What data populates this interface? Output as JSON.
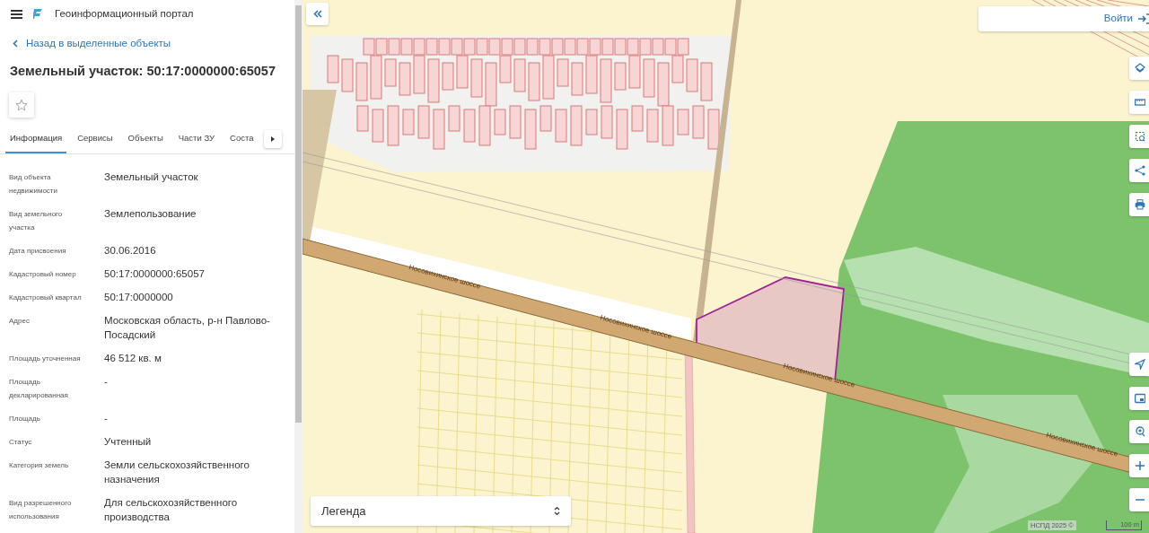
{
  "header": {
    "title": "Геоинформационный портал"
  },
  "back_link": "Назад в выделенные объекты",
  "object_title": "Земельный участок: 50:17:0000000:65057",
  "favorite": {
    "checked": false
  },
  "tabs": [
    {
      "label": "Информация",
      "selected": true
    },
    {
      "label": "Сервисы",
      "selected": false
    },
    {
      "label": "Объекты",
      "selected": false
    },
    {
      "label": "Части ЗУ",
      "selected": false
    },
    {
      "label": "Соста",
      "selected": false
    }
  ],
  "fields": [
    {
      "label": "Вид объекта недвижимости",
      "value": "Земельный участок"
    },
    {
      "label": "Вид земельного участка",
      "value": "Землепользование"
    },
    {
      "label": "Дата присвоения",
      "value": "30.06.2016"
    },
    {
      "label": "Кадастровый номер",
      "value": "50:17:0000000:65057"
    },
    {
      "label": "Кадастровый квартал",
      "value": "50:17:0000000"
    },
    {
      "label": "Адрес",
      "value": "Московская область, р-н Павлово-Посадский"
    },
    {
      "label": "Площадь уточненная",
      "value": "46 512 кв. м"
    },
    {
      "label": "Площадь декларированная",
      "value": "-"
    },
    {
      "label": "Площадь",
      "value": "-"
    },
    {
      "label": "Статус",
      "value": "Учтенный"
    },
    {
      "label": "Категория земель",
      "value": "Земли сельскохозяйственного назначения"
    },
    {
      "label": "Вид разрешенного использования",
      "value": "Для сельскохозяйственного производства"
    }
  ],
  "map": {
    "road_labels": [
      "Носовихинское шоссе",
      "Носовихинское шоссе",
      "Носовихинское шоссе",
      "Носовихинское шоссе"
    ],
    "login": "Войти",
    "legend": {
      "value": "Легенда"
    },
    "attribution": "НСПД 2025 ©",
    "scale": "100 m"
  }
}
